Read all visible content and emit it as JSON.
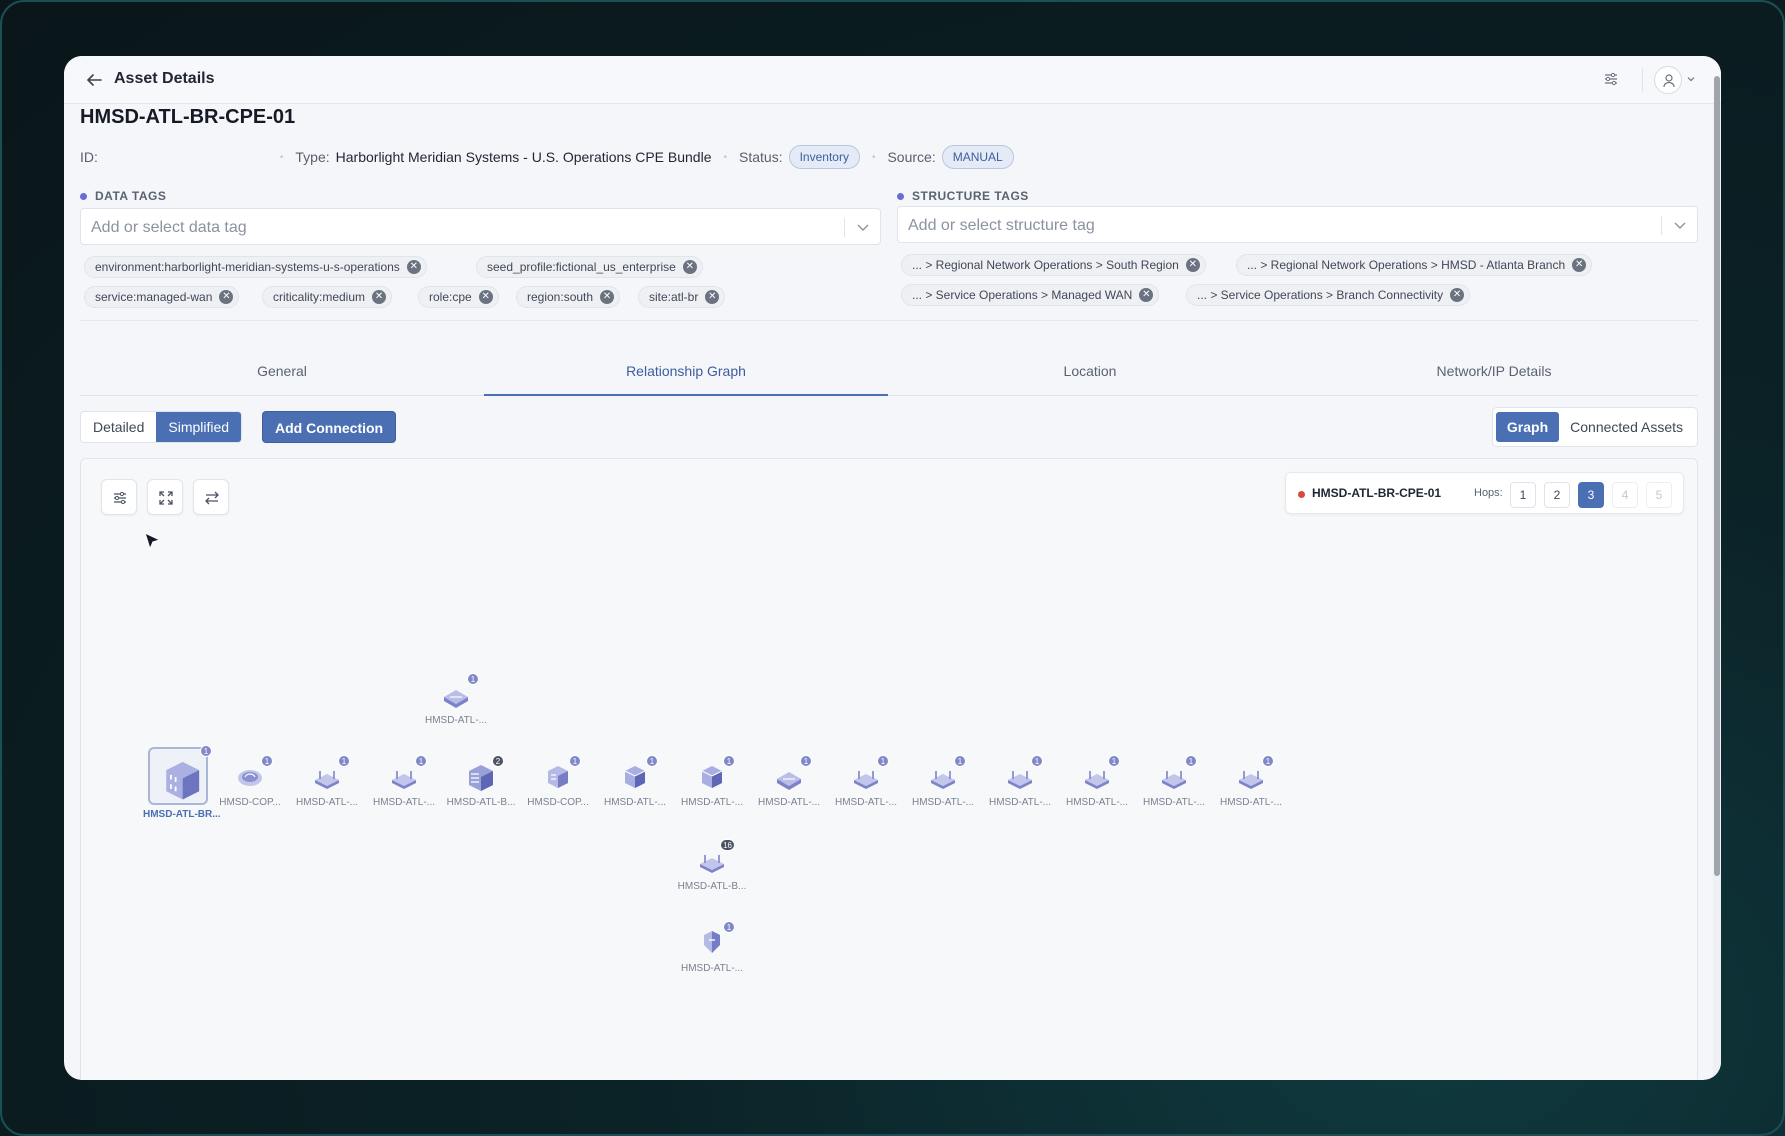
{
  "header": {
    "title": "Asset Details"
  },
  "asset": {
    "name": "HMSD-ATL-BR-CPE-01",
    "id_label": "ID:",
    "type_label": "Type:",
    "type_value": "Harborlight Meridian Systems - U.S. Operations CPE Bundle",
    "status_label": "Status:",
    "status_value": "Inventory",
    "source_label": "Source:",
    "source_value": "MANUAL"
  },
  "data_tags": {
    "label": "DATA TAGS",
    "placeholder": "Add or select data tag",
    "chips": [
      "environment:harborlight-meridian-systems-u-s-operations",
      "seed_profile:fictional_us_enterprise",
      "service:managed-wan",
      "criticality:medium",
      "role:cpe",
      "region:south",
      "site:atl-br"
    ]
  },
  "structure_tags": {
    "label": "STRUCTURE TAGS",
    "placeholder": "Add or select structure tag",
    "chips": [
      "... > Regional Network Operations > South Region",
      "... > Regional Network Operations > HMSD - Atlanta Branch",
      "... > Service Operations > Managed WAN",
      "... > Service Operations > Branch Connectivity"
    ]
  },
  "tabs": [
    "General",
    "Relationship Graph",
    "Location",
    "Network/IP Details"
  ],
  "active_tab": "Relationship Graph",
  "view_mode": {
    "detailed": "Detailed",
    "simplified": "Simplified",
    "selected": "Simplified"
  },
  "add_connection": "Add Connection",
  "right_toggle": {
    "graph": "Graph",
    "connected": "Connected Assets",
    "selected": "Graph"
  },
  "hops": {
    "root": "HMSD-ATL-BR-CPE-01",
    "label": "Hops:",
    "options": [
      "1",
      "2",
      "3",
      "4",
      "5"
    ],
    "selected": "3",
    "enabled_max": 3
  },
  "graph_nodes": [
    {
      "label": "HMSD-ATL-...",
      "badge": "1",
      "icon": "switch-icon"
    },
    {
      "label": "HMSD-ATL-BR...",
      "badge": "1",
      "icon": "building-icon",
      "root": true
    },
    {
      "label": "HMSD-COP...",
      "badge": "1",
      "icon": "cloud-icon"
    },
    {
      "label": "HMSD-ATL-...",
      "badge": "1",
      "icon": "router-icon"
    },
    {
      "label": "HMSD-ATL-...",
      "badge": "1",
      "icon": "router-icon"
    },
    {
      "label": "HMSD-ATL-B...",
      "badge": "2",
      "icon": "firewall-icon"
    },
    {
      "label": "HMSD-COP...",
      "badge": "1",
      "icon": "server-icon"
    },
    {
      "label": "HMSD-ATL-...",
      "badge": "1",
      "icon": "cube-icon"
    },
    {
      "label": "HMSD-ATL-...",
      "badge": "1",
      "icon": "cube-icon"
    },
    {
      "label": "HMSD-ATL-...",
      "badge": "1",
      "icon": "switch-icon"
    },
    {
      "label": "HMSD-ATL-...",
      "badge": "1",
      "icon": "router-icon"
    },
    {
      "label": "HMSD-ATL-...",
      "badge": "1",
      "icon": "router-icon"
    },
    {
      "label": "HMSD-ATL-...",
      "badge": "1",
      "icon": "router-icon"
    },
    {
      "label": "HMSD-ATL-...",
      "badge": "1",
      "icon": "router-icon"
    },
    {
      "label": "HMSD-ATL-...",
      "badge": "1",
      "icon": "router-icon"
    },
    {
      "label": "HMSD-ATL-...",
      "badge": "1",
      "icon": "router-icon"
    },
    {
      "label": "HMSD-ATL-B...",
      "badge": "16",
      "icon": "router-icon"
    },
    {
      "label": "HMSD-ATL-...",
      "badge": "1",
      "icon": "shield-icon"
    }
  ],
  "colors": {
    "accent": "#4a6fb3",
    "status_dot": "#d94a3e",
    "tag_bullet": "#6a6ad4"
  }
}
